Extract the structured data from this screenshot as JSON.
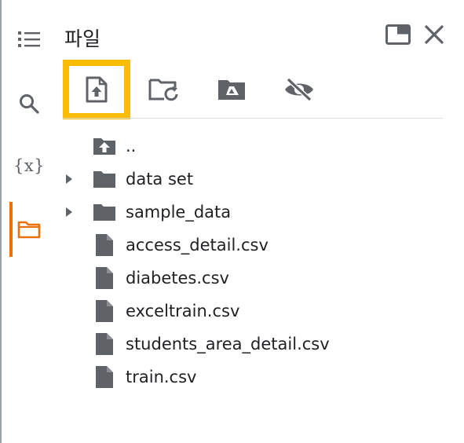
{
  "panel": {
    "title": "파일"
  },
  "rail": {
    "variables_label": "{x}"
  },
  "toolbar": {
    "buttons": [
      {
        "icon": "upload-file-icon",
        "highlighted": true
      },
      {
        "icon": "refresh-folder-icon",
        "highlighted": false
      },
      {
        "icon": "google-drive-icon",
        "highlighted": false
      },
      {
        "icon": "hide-files-icon",
        "highlighted": false
      }
    ]
  },
  "tree": {
    "parent": {
      "label": ".."
    },
    "folders": [
      {
        "label": "data set"
      },
      {
        "label": "sample_data"
      }
    ],
    "files": [
      {
        "label": "access_detail.csv"
      },
      {
        "label": "diabetes.csv"
      },
      {
        "label": "exceltrain.csv"
      },
      {
        "label": "students_area_detail.csv"
      },
      {
        "label": "train.csv"
      }
    ]
  },
  "colors": {
    "accent": "#e8710a",
    "highlight": "#fbbc04",
    "icon": "#5f6368"
  }
}
